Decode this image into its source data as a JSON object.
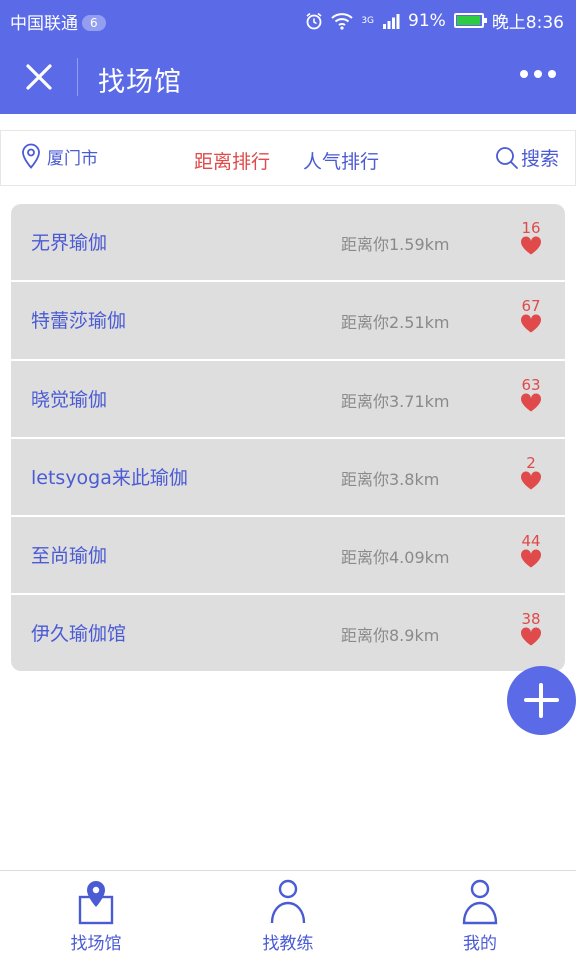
{
  "status_bar": {
    "carrier": "中国联通",
    "notification_count": "6",
    "network": "3G",
    "battery": "91%",
    "time": "晚上8:36"
  },
  "header": {
    "title": "找场馆"
  },
  "filter": {
    "city": "厦门市",
    "tab_distance": "距离排行",
    "tab_popular": "人气排行",
    "search_label": "搜索",
    "active_tab": "距离排行"
  },
  "venues": [
    {
      "name": "无界瑜伽",
      "distance": "距离你1.59km",
      "likes": "16"
    },
    {
      "name": "特蕾莎瑜伽",
      "distance": "距离你2.51km",
      "likes": "67"
    },
    {
      "name": "晓觉瑜伽",
      "distance": "距离你3.71km",
      "likes": "63"
    },
    {
      "name": "letsyoga来此瑜伽",
      "distance": "距离你3.8km",
      "likes": "2"
    },
    {
      "name": "至尚瑜伽",
      "distance": "距离你4.09km",
      "likes": "44"
    },
    {
      "name": "伊久瑜伽馆",
      "distance": "距离你8.9km",
      "likes": "38"
    }
  ],
  "bottom_nav": {
    "venue": "找场馆",
    "coach": "找教练",
    "me": "我的"
  },
  "colors": {
    "primary": "#5b6be8",
    "accent_red": "#e04a4a",
    "text_blue": "#4b5bd4",
    "row_bg": "#dedede"
  },
  "icons": {
    "close": "close-icon",
    "more": "more-dots-icon",
    "location": "location-pin-icon",
    "search": "search-icon",
    "heart": "heart-icon",
    "add": "plus-icon"
  }
}
